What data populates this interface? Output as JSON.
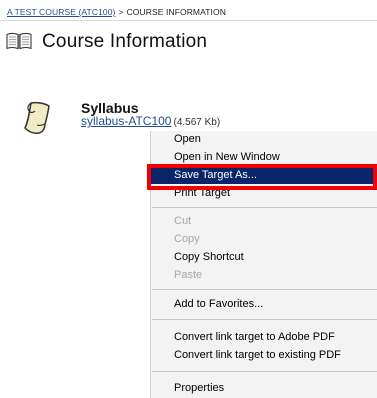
{
  "breadcrumb": {
    "course_label": "A TEST COURSE (ATC100)",
    "separator": ">",
    "current_label": "COURSE INFORMATION"
  },
  "page": {
    "title": "Course Information"
  },
  "item": {
    "title": "Syllabus",
    "link_label": "syllabus-ATC100",
    "file_size": "(4.567 Kb)"
  },
  "context_menu": {
    "items": [
      {
        "label": "Open",
        "state": "enabled"
      },
      {
        "label": "Open in New Window",
        "state": "enabled"
      },
      {
        "label": "Save Target As...",
        "state": "selected"
      },
      {
        "label": "Print Target",
        "state": "enabled"
      },
      {
        "label": "Cut",
        "state": "disabled"
      },
      {
        "label": "Copy",
        "state": "disabled"
      },
      {
        "label": "Copy Shortcut",
        "state": "enabled"
      },
      {
        "label": "Paste",
        "state": "disabled"
      },
      {
        "label": "Add to Favorites...",
        "state": "enabled"
      },
      {
        "label": "Convert link target to Adobe PDF",
        "state": "enabled"
      },
      {
        "label": "Convert link target to existing PDF",
        "state": "enabled"
      },
      {
        "label": "Properties",
        "state": "enabled"
      }
    ]
  },
  "icons": {
    "page_title_icon": "book-icon",
    "item_icon": "document-scroll-icon"
  },
  "colors": {
    "link": "#1f4f92",
    "menu_bg": "#f3f3f3",
    "menu_selected": "#0a246a",
    "highlight": "#f20000"
  }
}
